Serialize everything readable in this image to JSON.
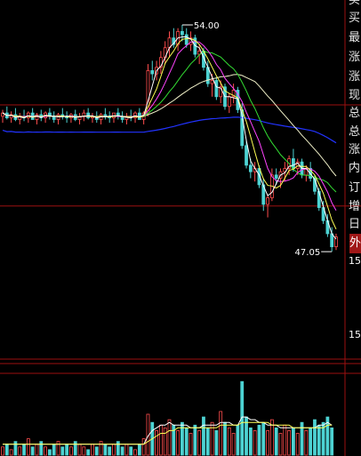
{
  "panel": {
    "labels": [
      "买",
      "买",
      "最",
      "涨",
      "涨",
      "现",
      "总",
      "总",
      "涨",
      "内",
      "订",
      "增",
      "日",
      "外"
    ],
    "numbers": [
      "15",
      "15"
    ]
  },
  "chart_data": {
    "type": "candlestick",
    "xlabel": "",
    "ylabel": "",
    "price_ylim": [
      45.5,
      54.6
    ],
    "high_marker": "54.00",
    "low_marker": "47.05",
    "colors": {
      "up": "#ff4d4d",
      "down": "#4dd2d2",
      "ma5": "#ffffff",
      "ma10": "#ffff55",
      "ma20": "#ff44ff",
      "ma30": "#33dd33",
      "ma60": "#f0f0c8",
      "ma120": "#2233ff",
      "grid": "#9b1010"
    },
    "candles": [
      [
        51.2,
        51.4,
        51.0,
        51.3
      ],
      [
        51.3,
        51.5,
        51.1,
        51.15
      ],
      [
        51.15,
        51.35,
        51.0,
        51.25
      ],
      [
        51.25,
        51.45,
        51.05,
        51.1
      ],
      [
        51.1,
        51.3,
        50.95,
        51.2
      ],
      [
        51.2,
        51.4,
        51.05,
        51.15
      ],
      [
        51.15,
        51.35,
        51.0,
        51.3
      ],
      [
        51.3,
        51.45,
        51.1,
        51.1
      ],
      [
        51.1,
        51.3,
        50.95,
        51.25
      ],
      [
        51.25,
        51.4,
        51.05,
        51.15
      ],
      [
        51.15,
        51.35,
        51.0,
        51.3
      ],
      [
        51.3,
        51.45,
        51.1,
        51.2
      ],
      [
        51.2,
        51.35,
        51.0,
        51.1
      ],
      [
        51.1,
        51.3,
        50.95,
        51.25
      ],
      [
        51.25,
        51.45,
        51.1,
        51.2
      ],
      [
        51.2,
        51.35,
        51.0,
        51.15
      ],
      [
        51.15,
        51.3,
        51.0,
        51.25
      ],
      [
        51.25,
        51.4,
        51.05,
        51.1
      ],
      [
        51.1,
        51.3,
        50.95,
        51.2
      ],
      [
        51.2,
        51.4,
        51.05,
        51.3
      ],
      [
        51.3,
        51.45,
        51.1,
        51.15
      ],
      [
        51.15,
        51.3,
        51.0,
        51.2
      ],
      [
        51.2,
        51.35,
        51.0,
        51.1
      ],
      [
        51.1,
        51.3,
        50.95,
        51.25
      ],
      [
        51.25,
        51.45,
        51.1,
        51.2
      ],
      [
        51.2,
        51.35,
        51.0,
        51.15
      ],
      [
        51.15,
        51.3,
        51.0,
        51.3
      ],
      [
        51.3,
        51.45,
        51.1,
        51.2
      ],
      [
        51.2,
        51.35,
        51.0,
        51.1
      ],
      [
        51.1,
        51.3,
        50.95,
        51.2
      ],
      [
        51.2,
        51.4,
        51.05,
        51.15
      ],
      [
        51.15,
        51.35,
        51.0,
        51.3
      ],
      [
        51.3,
        51.45,
        51.1,
        51.1
      ],
      [
        51.1,
        51.35,
        50.95,
        51.3
      ],
      [
        51.3,
        52.8,
        51.2,
        52.6
      ],
      [
        52.6,
        52.9,
        52.3,
        52.5
      ],
      [
        52.5,
        52.9,
        52.3,
        52.7
      ],
      [
        52.7,
        53.2,
        52.5,
        53.0
      ],
      [
        53.0,
        53.5,
        52.8,
        53.3
      ],
      [
        53.3,
        53.8,
        53.0,
        53.6
      ],
      [
        53.6,
        53.9,
        53.3,
        53.4
      ],
      [
        53.4,
        53.9,
        53.2,
        53.8
      ],
      [
        53.8,
        54.0,
        53.5,
        53.7
      ],
      [
        53.7,
        53.9,
        53.3,
        53.4
      ],
      [
        53.4,
        53.8,
        53.2,
        53.6
      ],
      [
        53.6,
        53.7,
        53.0,
        53.1
      ],
      [
        53.1,
        53.4,
        52.8,
        53.2
      ],
      [
        53.2,
        53.3,
        52.6,
        52.7
      ],
      [
        52.7,
        52.9,
        52.1,
        52.2
      ],
      [
        52.2,
        52.5,
        51.8,
        52.3
      ],
      [
        52.3,
        52.4,
        51.7,
        51.8
      ],
      [
        51.8,
        52.3,
        51.6,
        52.1
      ],
      [
        52.1,
        52.2,
        51.4,
        51.5
      ],
      [
        51.5,
        51.9,
        51.3,
        51.8
      ],
      [
        51.8,
        52.2,
        51.6,
        52.0
      ],
      [
        52.0,
        52.1,
        51.3,
        51.4
      ],
      [
        51.4,
        51.6,
        50.2,
        50.3
      ],
      [
        50.3,
        50.5,
        49.6,
        49.7
      ],
      [
        49.7,
        49.9,
        49.3,
        49.5
      ],
      [
        49.5,
        49.8,
        49.2,
        49.6
      ],
      [
        49.6,
        49.7,
        49.0,
        49.1
      ],
      [
        49.1,
        49.3,
        48.3,
        48.5
      ],
      [
        48.5,
        48.8,
        48.1,
        48.7
      ],
      [
        48.7,
        49.6,
        48.6,
        49.4
      ],
      [
        49.4,
        49.6,
        49.1,
        49.3
      ],
      [
        49.3,
        49.6,
        49.0,
        49.5
      ],
      [
        49.5,
        49.8,
        49.2,
        49.6
      ],
      [
        49.6,
        50.0,
        49.4,
        49.9
      ],
      [
        49.9,
        50.2,
        49.5,
        49.6
      ],
      [
        49.6,
        49.9,
        49.4,
        49.8
      ],
      [
        49.8,
        49.9,
        49.3,
        49.4
      ],
      [
        49.4,
        49.7,
        49.2,
        49.6
      ],
      [
        49.6,
        49.8,
        49.2,
        49.3
      ],
      [
        49.3,
        49.4,
        48.8,
        48.9
      ],
      [
        48.9,
        49.0,
        48.3,
        48.4
      ],
      [
        48.4,
        48.6,
        47.9,
        48.0
      ],
      [
        48.0,
        48.2,
        47.5,
        47.6
      ],
      [
        47.6,
        47.8,
        47.05,
        47.2
      ],
      [
        47.2,
        47.6,
        47.1,
        47.5
      ]
    ],
    "volume": [
      3,
      4,
      2,
      5,
      3,
      4,
      6,
      3,
      4,
      5,
      3,
      2,
      4,
      5,
      3,
      4,
      3,
      5,
      4,
      3,
      2,
      4,
      3,
      5,
      4,
      3,
      4,
      5,
      3,
      4,
      3,
      2,
      4,
      6,
      15,
      12,
      9,
      11,
      10,
      13,
      11,
      9,
      12,
      10,
      8,
      11,
      9,
      14,
      10,
      12,
      9,
      16,
      12,
      10,
      8,
      11,
      27,
      14,
      10,
      9,
      11,
      12,
      9,
      13,
      10,
      8,
      11,
      9,
      10,
      8,
      12,
      9,
      10,
      13,
      11,
      12,
      14,
      10
    ],
    "vol_ylim": [
      0,
      30
    ],
    "volume_ma": [
      [
        4,
        4,
        4,
        4,
        4,
        4,
        4,
        4,
        4,
        4,
        4,
        4,
        4,
        4,
        4,
        4,
        4,
        4,
        4,
        4,
        4,
        4,
        4,
        4,
        4,
        4,
        4,
        4,
        4,
        4,
        4,
        4,
        4,
        4,
        7,
        9,
        10,
        11,
        11,
        12,
        11,
        11,
        11,
        11,
        10,
        10,
        10,
        11,
        11,
        11,
        11,
        12,
        12,
        12,
        11,
        11,
        14,
        14,
        13,
        13,
        12,
        12,
        11,
        11,
        11,
        10,
        10,
        10,
        10,
        10,
        10,
        10,
        10,
        10,
        11,
        11,
        12,
        11
      ],
      [
        4,
        4,
        4,
        4,
        4,
        4,
        4,
        4,
        4,
        4,
        4,
        4,
        4,
        4,
        4,
        4,
        4,
        4,
        4,
        4,
        4,
        4,
        4,
        4,
        4,
        4,
        4,
        4,
        4,
        4,
        4,
        4,
        4,
        4,
        5,
        6,
        7,
        8,
        8,
        9,
        9,
        10,
        10,
        10,
        10,
        10,
        10,
        10,
        10,
        10,
        10,
        11,
        11,
        11,
        11,
        11,
        12,
        12,
        12,
        12,
        12,
        12,
        12,
        11,
        11,
        11,
        11,
        11,
        10,
        10,
        10,
        10,
        10,
        10,
        10,
        10,
        11,
        11
      ]
    ]
  }
}
